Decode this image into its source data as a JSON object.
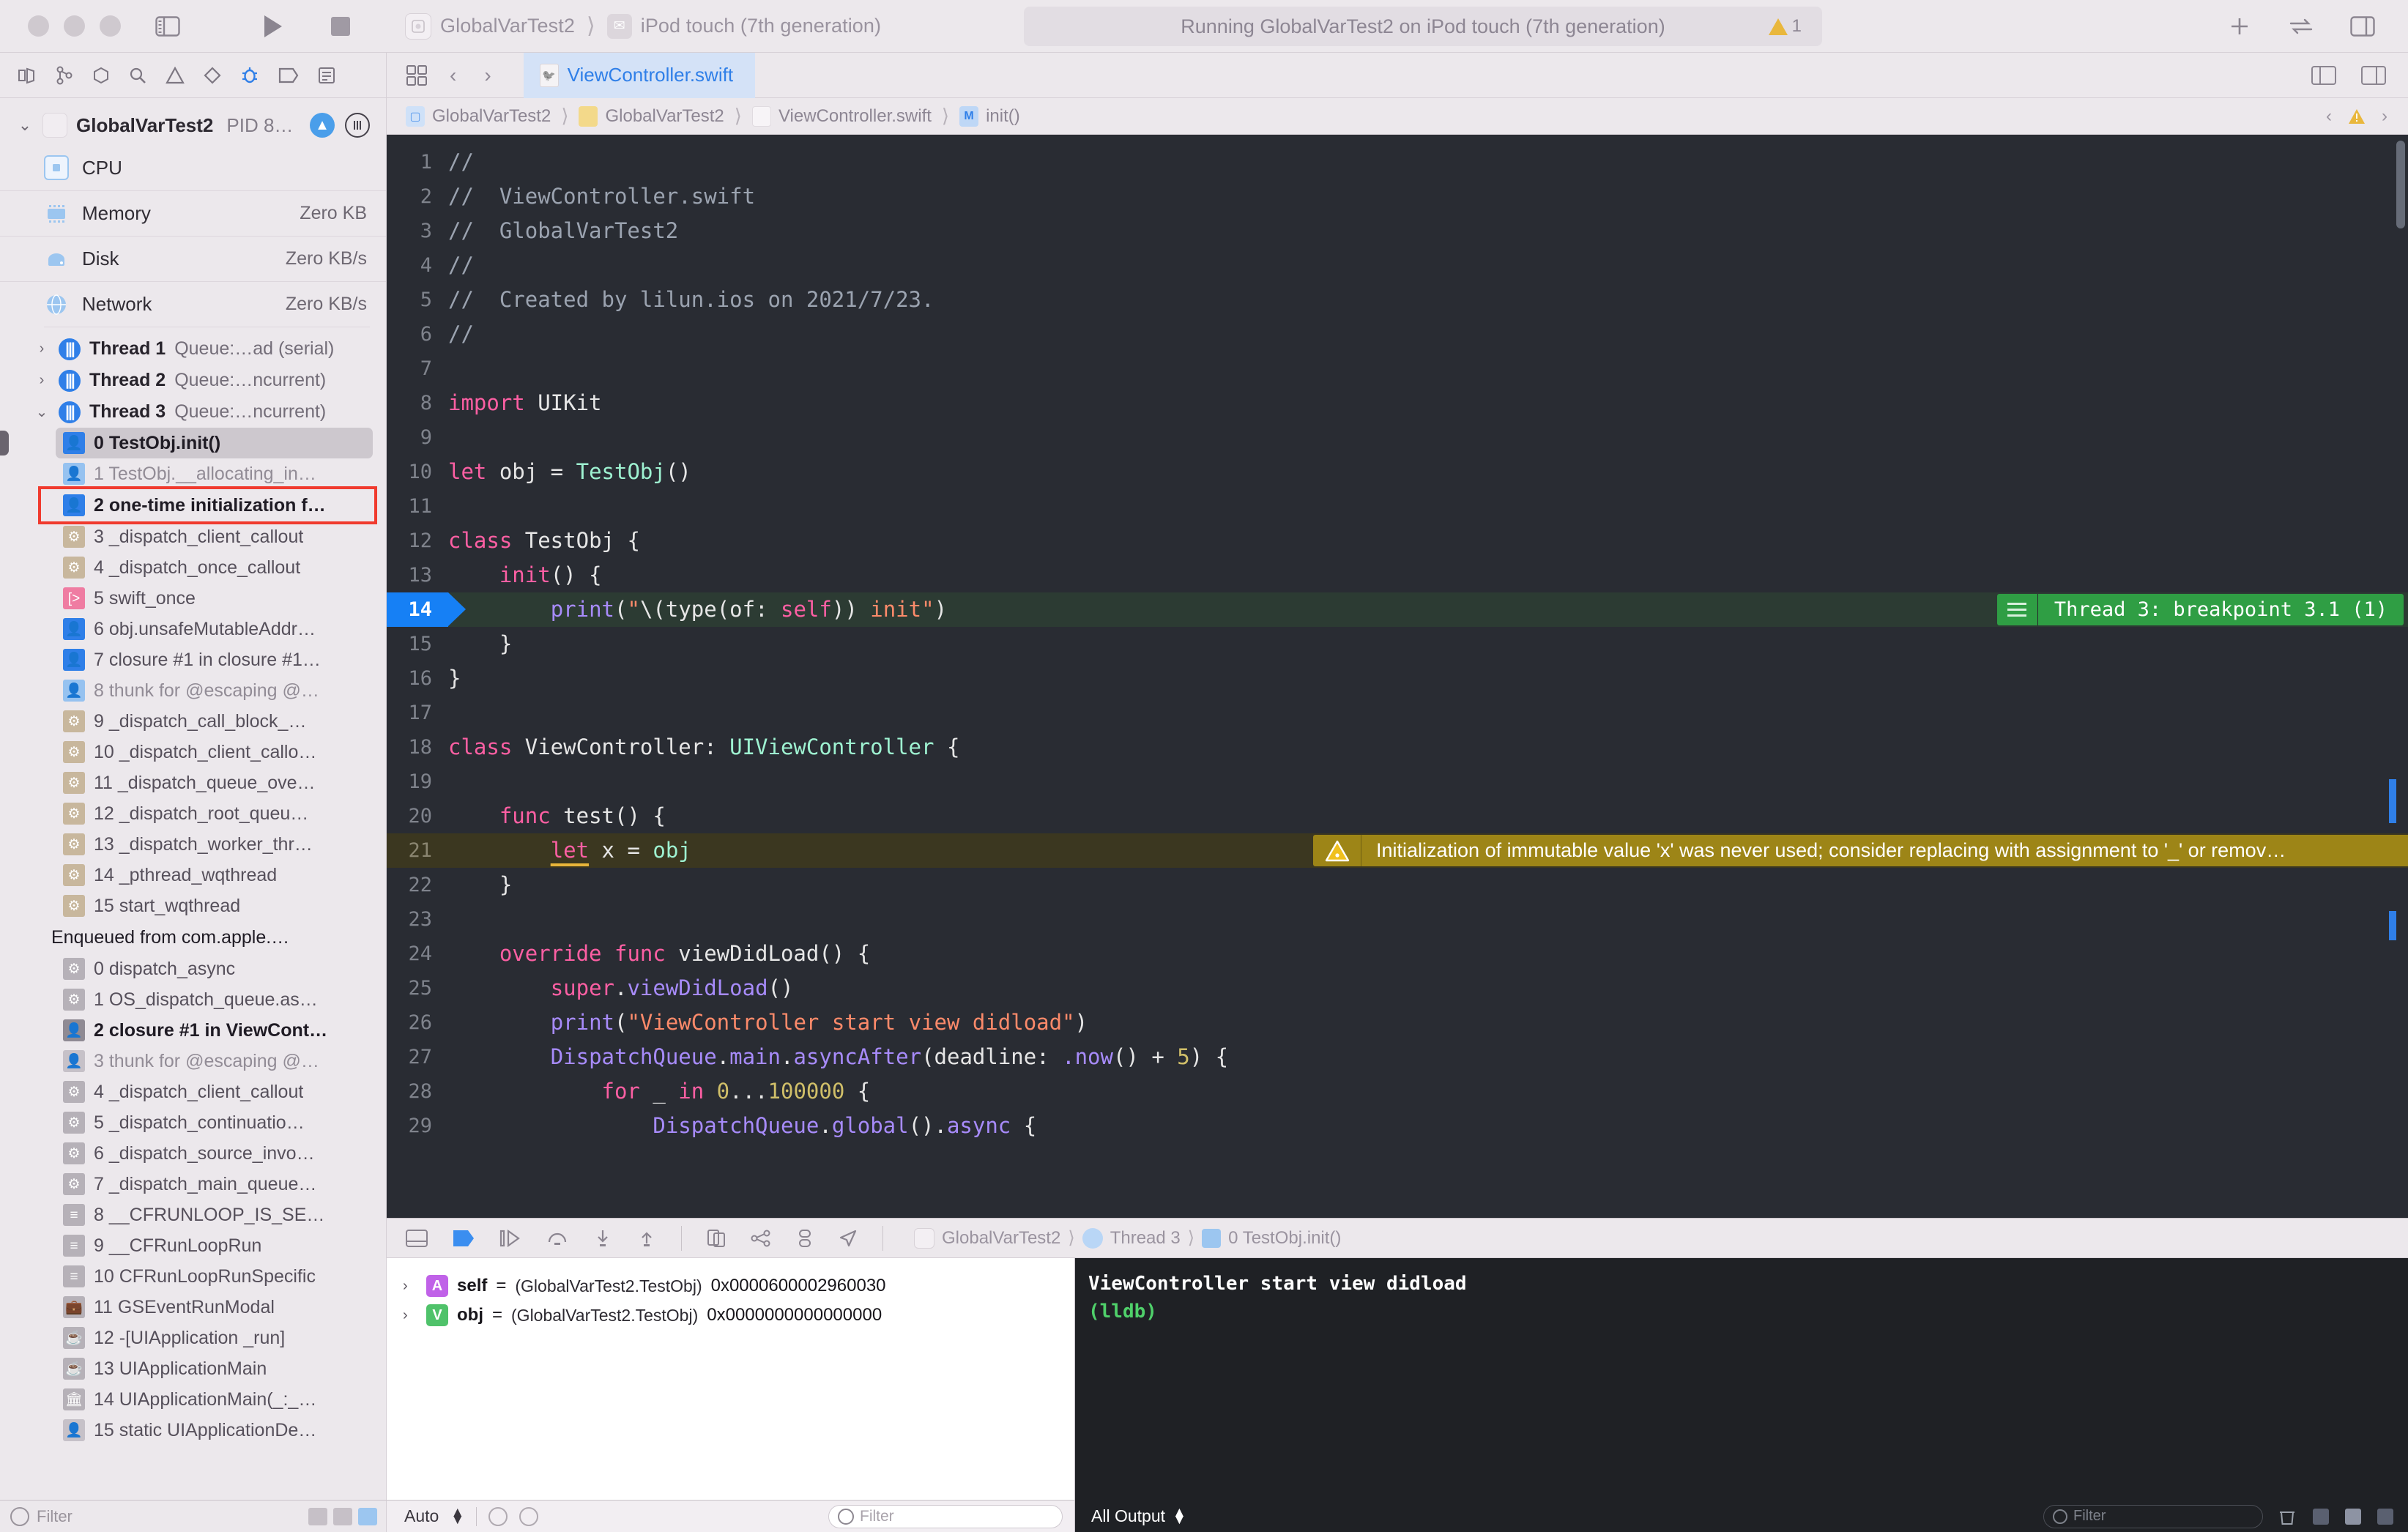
{
  "titlebar": {
    "scheme": "GlobalVarTest2",
    "device": "iPod touch (7th generation)",
    "status": "Running GlobalVarTest2 on iPod touch (7th generation)",
    "warning_count": "1",
    "run_icon": "run-icon",
    "stop_icon": "stop-icon",
    "sidebar_icon": "toggle-navigator-icon",
    "add_icon": "add-icon",
    "library_icon": "library-icon"
  },
  "toolbar2": {
    "icons": [
      "project-navigator-icon",
      "source-control-icon",
      "symbol-navigator-icon",
      "find-navigator-icon",
      "issue-navigator-icon",
      "test-navigator-icon",
      "debug-navigator-icon",
      "breakpoint-navigator-icon",
      "report-navigator-icon"
    ],
    "back_label": "‹",
    "forward_label": "›",
    "active_tab": "ViewController.swift"
  },
  "navigator": {
    "process": {
      "name": "GlobalVarTest2",
      "pid": "PID 8…"
    },
    "gauges": [
      {
        "label": "CPU",
        "value": ""
      },
      {
        "label": "Memory",
        "value": "Zero KB"
      },
      {
        "label": "Disk",
        "value": "Zero KB/s"
      },
      {
        "label": "Network",
        "value": "Zero KB/s"
      }
    ],
    "threads": [
      {
        "name": "Thread 1",
        "queue": "Queue:…ad (serial)",
        "expanded": false
      },
      {
        "name": "Thread 2",
        "queue": "Queue:…ncurrent)",
        "expanded": false
      },
      {
        "name": "Thread 3",
        "queue": "Queue:…ncurrent)",
        "expanded": true
      }
    ],
    "frames": [
      {
        "label": "0 TestObj.init()",
        "icon": "user-frame-icon",
        "style": "user",
        "state": "selected"
      },
      {
        "label": "1 TestObj.__allocating_in…",
        "icon": "user-frame-icon",
        "style": "user-dim",
        "state": "dim"
      },
      {
        "label": "2 one-time initialization f…",
        "icon": "user-frame-icon",
        "style": "user",
        "state": "highlighted"
      },
      {
        "label": "3 _dispatch_client_callout",
        "icon": "system-frame-icon",
        "style": "gear",
        "state": "normal"
      },
      {
        "label": "4 _dispatch_once_callout",
        "icon": "system-frame-icon",
        "style": "gear",
        "state": "normal"
      },
      {
        "label": "5 swift_once",
        "icon": "swift-runtime-icon",
        "style": "swift",
        "state": "normal"
      },
      {
        "label": "6 obj.unsafeMutableAddr…",
        "icon": "user-frame-icon",
        "style": "user",
        "state": "normal"
      },
      {
        "label": "7 closure #1 in closure #1…",
        "icon": "user-frame-icon",
        "style": "user",
        "state": "normal"
      },
      {
        "label": "8 thunk for @escaping @…",
        "icon": "user-frame-icon",
        "style": "user-dim",
        "state": "dim"
      },
      {
        "label": "9 _dispatch_call_block_…",
        "icon": "system-frame-icon",
        "style": "gear",
        "state": "normal"
      },
      {
        "label": "10 _dispatch_client_callo…",
        "icon": "system-frame-icon",
        "style": "gear",
        "state": "normal"
      },
      {
        "label": "11 _dispatch_queue_ove…",
        "icon": "system-frame-icon",
        "style": "gear",
        "state": "normal"
      },
      {
        "label": "12 _dispatch_root_queu…",
        "icon": "system-frame-icon",
        "style": "gear",
        "state": "normal"
      },
      {
        "label": "13 _dispatch_worker_thr…",
        "icon": "system-frame-icon",
        "style": "gear",
        "state": "normal"
      },
      {
        "label": "14 _pthread_wqthread",
        "icon": "system-frame-icon",
        "style": "gear",
        "state": "normal"
      },
      {
        "label": "15 start_wqthread",
        "icon": "system-frame-icon",
        "style": "gear",
        "state": "normal"
      }
    ],
    "enqueued_label": "Enqueued from com.apple.…",
    "enqueued_frames": [
      {
        "label": "0 dispatch_async",
        "icon": "system-frame-icon",
        "style": "gear-grey",
        "state": "normal"
      },
      {
        "label": "1 OS_dispatch_queue.as…",
        "icon": "system-frame-icon",
        "style": "gear-grey",
        "state": "normal"
      },
      {
        "label": "2 closure #1 in ViewCont…",
        "icon": "user-frame-icon",
        "style": "user-grey",
        "state": "strong"
      },
      {
        "label": "3 thunk for @escaping @…",
        "icon": "user-frame-icon",
        "style": "user-grey-dim",
        "state": "dim"
      },
      {
        "label": "4 _dispatch_client_callout",
        "icon": "system-frame-icon",
        "style": "gear-grey",
        "state": "normal"
      },
      {
        "label": "5 _dispatch_continuatio…",
        "icon": "system-frame-icon",
        "style": "gear-grey",
        "state": "normal"
      },
      {
        "label": "6 _dispatch_source_invo…",
        "icon": "system-frame-icon",
        "style": "gear-grey",
        "state": "normal"
      },
      {
        "label": "7 _dispatch_main_queue…",
        "icon": "system-frame-icon",
        "style": "gear-grey",
        "state": "normal"
      },
      {
        "label": "8 __CFRUNLOOP_IS_SE…",
        "icon": "corefoundation-frame-icon",
        "style": "cf",
        "state": "normal"
      },
      {
        "label": "9 __CFRunLoopRun",
        "icon": "corefoundation-frame-icon",
        "style": "cf",
        "state": "normal"
      },
      {
        "label": "10 CFRunLoopRunSpecific",
        "icon": "corefoundation-frame-icon",
        "style": "cf",
        "state": "normal"
      },
      {
        "label": "11 GSEventRunModal",
        "icon": "briefcase-frame-icon",
        "style": "brief",
        "state": "normal"
      },
      {
        "label": "12 -[UIApplication _run]",
        "icon": "objc-frame-icon",
        "style": "cup",
        "state": "normal"
      },
      {
        "label": "13 UIApplicationMain",
        "icon": "objc-frame-icon",
        "style": "cup",
        "state": "normal"
      },
      {
        "label": "14 UIApplicationMain(_:_…",
        "icon": "library-frame-icon",
        "style": "bank",
        "state": "normal"
      },
      {
        "label": "15 static UIApplicationDe…",
        "icon": "user-frame-icon",
        "style": "user-grey-dim",
        "state": "normal"
      }
    ],
    "filter_placeholder": "Filter"
  },
  "jumpbar": {
    "crumbs": [
      "GlobalVarTest2",
      "GlobalVarTest2",
      "ViewController.swift",
      "init()"
    ]
  },
  "editor": {
    "lines": [
      {
        "n": "1",
        "tokens": [
          {
            "t": "//",
            "c": "c-cmt"
          }
        ]
      },
      {
        "n": "2",
        "tokens": [
          {
            "t": "//  ViewController.swift",
            "c": "c-cmt"
          }
        ]
      },
      {
        "n": "3",
        "tokens": [
          {
            "t": "//  GlobalVarTest2",
            "c": "c-cmt"
          }
        ]
      },
      {
        "n": "4",
        "tokens": [
          {
            "t": "//",
            "c": "c-cmt"
          }
        ]
      },
      {
        "n": "5",
        "tokens": [
          {
            "t": "//  Created by lilun.ios on 2021/7/23.",
            "c": "c-cmt"
          }
        ]
      },
      {
        "n": "6",
        "tokens": [
          {
            "t": "//",
            "c": "c-cmt"
          }
        ]
      },
      {
        "n": "7",
        "tokens": []
      },
      {
        "n": "8",
        "tokens": [
          {
            "t": "import ",
            "c": "c-kw"
          },
          {
            "t": "UIKit",
            "c": "c-plain"
          }
        ]
      },
      {
        "n": "9",
        "tokens": []
      },
      {
        "n": "10",
        "tokens": [
          {
            "t": "let ",
            "c": "c-kw"
          },
          {
            "t": "obj = ",
            "c": "c-plain"
          },
          {
            "t": "TestObj",
            "c": "c-type"
          },
          {
            "t": "()",
            "c": "c-plain"
          }
        ]
      },
      {
        "n": "11",
        "tokens": []
      },
      {
        "n": "12",
        "tokens": [
          {
            "t": "class ",
            "c": "c-kw"
          },
          {
            "t": "TestObj {",
            "c": "c-plain"
          }
        ]
      },
      {
        "n": "13",
        "tokens": [
          {
            "t": "    ",
            "c": "c-plain"
          },
          {
            "t": "init",
            "c": "c-kw"
          },
          {
            "t": "() {",
            "c": "c-plain"
          }
        ]
      },
      {
        "n": "14",
        "tokens": [
          {
            "t": "        ",
            "c": "c-plain"
          },
          {
            "t": "print",
            "c": "c-fn"
          },
          {
            "t": "(",
            "c": "c-plain"
          },
          {
            "t": "\"",
            "c": "c-str"
          },
          {
            "t": "\\(",
            "c": "c-plain"
          },
          {
            "t": "type",
            "c": "c-plain"
          },
          {
            "t": "(of: ",
            "c": "c-plain"
          },
          {
            "t": "self",
            "c": "c-self"
          },
          {
            "t": ")) ",
            "c": "c-plain"
          },
          {
            "t": "init\"",
            "c": "c-str"
          },
          {
            "t": ")",
            "c": "c-plain"
          }
        ]
      },
      {
        "n": "15",
        "tokens": [
          {
            "t": "    }",
            "c": "c-plain"
          }
        ]
      },
      {
        "n": "16",
        "tokens": [
          {
            "t": "}",
            "c": "c-plain"
          }
        ]
      },
      {
        "n": "17",
        "tokens": []
      },
      {
        "n": "18",
        "tokens": [
          {
            "t": "class ",
            "c": "c-kw"
          },
          {
            "t": "ViewController: ",
            "c": "c-plain"
          },
          {
            "t": "UIViewController",
            "c": "c-type"
          },
          {
            "t": " {",
            "c": "c-plain"
          }
        ]
      },
      {
        "n": "19",
        "tokens": []
      },
      {
        "n": "20",
        "tokens": [
          {
            "t": "    ",
            "c": "c-plain"
          },
          {
            "t": "func ",
            "c": "c-kw"
          },
          {
            "t": "test() {",
            "c": "c-plain"
          }
        ]
      },
      {
        "n": "21",
        "tokens": [
          {
            "t": "        ",
            "c": "c-plain"
          },
          {
            "t": "let",
            "c": "c-kw uline"
          },
          {
            "t": " x = ",
            "c": "c-plain"
          },
          {
            "t": "obj",
            "c": "c-type"
          }
        ]
      },
      {
        "n": "22",
        "tokens": [
          {
            "t": "    }",
            "c": "c-plain"
          }
        ]
      },
      {
        "n": "23",
        "tokens": []
      },
      {
        "n": "24",
        "tokens": [
          {
            "t": "    ",
            "c": "c-plain"
          },
          {
            "t": "override func ",
            "c": "c-kw"
          },
          {
            "t": "viewDidLoad() {",
            "c": "c-plain"
          }
        ]
      },
      {
        "n": "25",
        "tokens": [
          {
            "t": "        ",
            "c": "c-plain"
          },
          {
            "t": "super",
            "c": "c-kw"
          },
          {
            "t": ".",
            "c": "c-plain"
          },
          {
            "t": "viewDidLoad",
            "c": "c-fn"
          },
          {
            "t": "()",
            "c": "c-plain"
          }
        ]
      },
      {
        "n": "26",
        "tokens": [
          {
            "t": "        ",
            "c": "c-plain"
          },
          {
            "t": "print",
            "c": "c-fn"
          },
          {
            "t": "(",
            "c": "c-plain"
          },
          {
            "t": "\"ViewController start view didload\"",
            "c": "c-str"
          },
          {
            "t": ")",
            "c": "c-plain"
          }
        ]
      },
      {
        "n": "27",
        "tokens": [
          {
            "t": "        ",
            "c": "c-plain"
          },
          {
            "t": "DispatchQueue",
            "c": "c-fn"
          },
          {
            "t": ".",
            "c": "c-plain"
          },
          {
            "t": "main",
            "c": "c-fn"
          },
          {
            "t": ".",
            "c": "c-plain"
          },
          {
            "t": "asyncAfter",
            "c": "c-fn"
          },
          {
            "t": "(deadline: ",
            "c": "c-plain"
          },
          {
            "t": ".now",
            "c": "c-fn"
          },
          {
            "t": "() + ",
            "c": "c-plain"
          },
          {
            "t": "5",
            "c": "c-num"
          },
          {
            "t": ") {",
            "c": "c-plain"
          }
        ]
      },
      {
        "n": "28",
        "tokens": [
          {
            "t": "            ",
            "c": "c-plain"
          },
          {
            "t": "for ",
            "c": "c-kw"
          },
          {
            "t": "_ ",
            "c": "c-plain"
          },
          {
            "t": "in ",
            "c": "c-kw"
          },
          {
            "t": "0",
            "c": "c-num"
          },
          {
            "t": "...",
            "c": "c-plain"
          },
          {
            "t": "100000",
            "c": "c-num"
          },
          {
            "t": " {",
            "c": "c-plain"
          }
        ]
      },
      {
        "n": "29",
        "tokens": [
          {
            "t": "                ",
            "c": "c-plain"
          },
          {
            "t": "DispatchQueue",
            "c": "c-fn"
          },
          {
            "t": ".",
            "c": "c-plain"
          },
          {
            "t": "global",
            "c": "c-fn"
          },
          {
            "t": "().",
            "c": "c-plain"
          },
          {
            "t": "async",
            "c": "c-fn"
          },
          {
            "t": " {",
            "c": "c-plain"
          }
        ]
      }
    ],
    "breakpoint_line": "14",
    "breakpoint_message": "Thread 3: breakpoint 3.1 (1)",
    "warning_line": "21",
    "warning_message": "Initialization of immutable value 'x' was never used; consider replacing with assignment to '_' or remov…"
  },
  "debug": {
    "crumbs": [
      "GlobalVarTest2",
      "Thread 3",
      "0 TestObj.init()"
    ],
    "variables": [
      {
        "badge": "A",
        "badge_kind": "a",
        "name": "self",
        "eq": " = ",
        "type": "(GlobalVarTest2.TestObj)",
        "value": " 0x0000600002960030"
      },
      {
        "badge": "V",
        "badge_kind": "v",
        "name": "obj",
        "eq": " = ",
        "type": "(GlobalVarTest2.TestObj)",
        "value": " 0x0000000000000000"
      }
    ],
    "console": [
      {
        "text": "ViewController start view didload",
        "kind": "out"
      },
      {
        "text": "(lldb)",
        "kind": "lldb"
      }
    ],
    "vars_scope": "Auto",
    "vars_filter_placeholder": "Filter",
    "console_scope": "All Output",
    "console_filter_placeholder": "Filter"
  },
  "colors": {
    "accent_blue": "#2f7fe8",
    "breakpoint_green": "#2f9e44",
    "warning_olive": "#9d8517",
    "highlight_red": "#f03a2e",
    "editor_bg": "#292c33"
  }
}
